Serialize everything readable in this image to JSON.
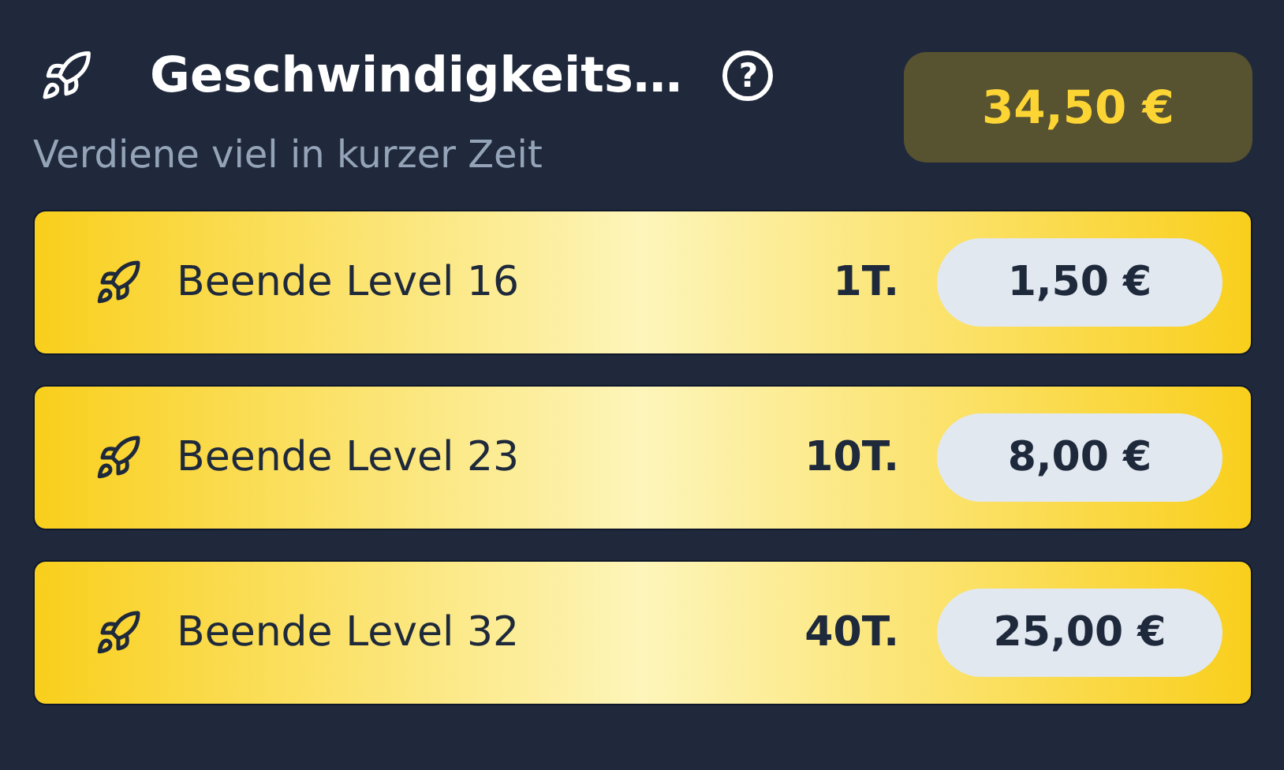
{
  "header": {
    "title": "Geschwindigkeits…",
    "help": "?",
    "subtitle": "Verdiene viel in kurzer Zeit",
    "total": "34,50 €"
  },
  "tasks": [
    {
      "label": "Beende Level 16",
      "days": "1T.",
      "reward": "1,50 €"
    },
    {
      "label": "Beende Level 23",
      "days": "10T.",
      "reward": "8,00 €"
    },
    {
      "label": "Beende Level 32",
      "days": "40T.",
      "reward": "25,00 €"
    }
  ]
}
